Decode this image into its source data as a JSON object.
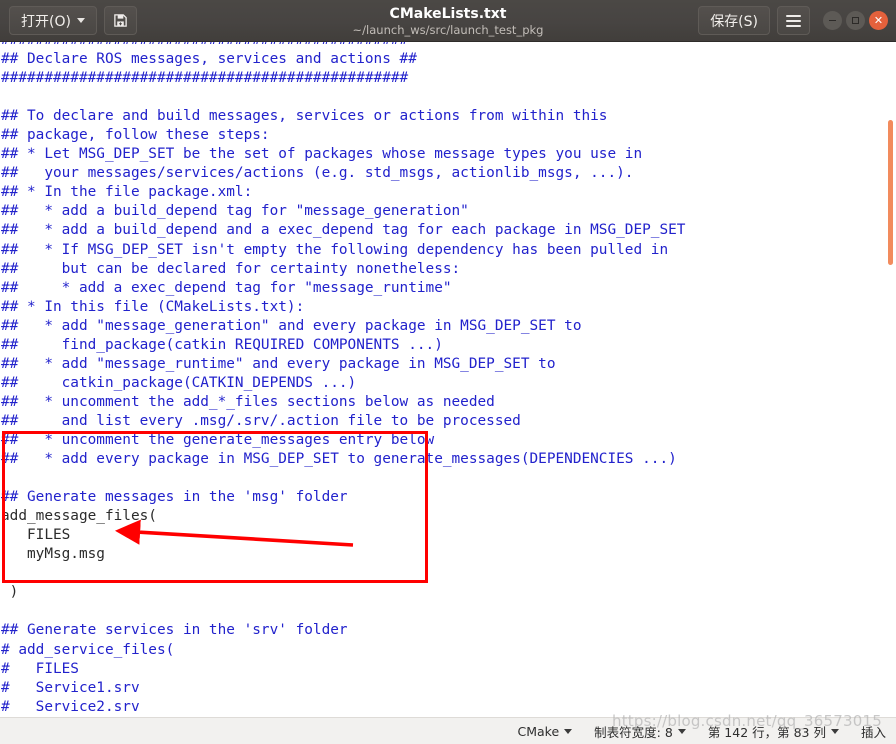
{
  "titlebar": {
    "open_label": "打开(O)",
    "saveas_icon": "save-as-icon",
    "title": "CMakeLists.txt",
    "subtitle": "~/launch_ws/src/launch_test_pkg",
    "save_label": "保存(S)",
    "menu_icon": "hamburger-menu-icon",
    "minimize_icon": "minimize-icon",
    "maximize_icon": "maximize-icon",
    "close_icon": "close-icon"
  },
  "editor": {
    "lines": [
      {
        "text": "###############################################",
        "style": "comment"
      },
      {
        "text": "## Declare ROS messages, services and actions ##",
        "style": "comment"
      },
      {
        "text": "###############################################",
        "style": "comment"
      },
      {
        "text": "",
        "style": "comment"
      },
      {
        "text": "## To declare and build messages, services or actions from within this",
        "style": "comment"
      },
      {
        "text": "## package, follow these steps:",
        "style": "comment"
      },
      {
        "text": "## * Let MSG_DEP_SET be the set of packages whose message types you use in",
        "style": "comment"
      },
      {
        "text": "##   your messages/services/actions (e.g. std_msgs, actionlib_msgs, ...).",
        "style": "comment"
      },
      {
        "text": "## * In the file package.xml:",
        "style": "comment"
      },
      {
        "text": "##   * add a build_depend tag for \"message_generation\"",
        "style": "comment"
      },
      {
        "text": "##   * add a build_depend and a exec_depend tag for each package in MSG_DEP_SET",
        "style": "comment"
      },
      {
        "text": "##   * If MSG_DEP_SET isn't empty the following dependency has been pulled in",
        "style": "comment"
      },
      {
        "text": "##     but can be declared for certainty nonetheless:",
        "style": "comment"
      },
      {
        "text": "##     * add a exec_depend tag for \"message_runtime\"",
        "style": "comment"
      },
      {
        "text": "## * In this file (CMakeLists.txt):",
        "style": "comment"
      },
      {
        "text": "##   * add \"message_generation\" and every package in MSG_DEP_SET to",
        "style": "comment"
      },
      {
        "text": "##     find_package(catkin REQUIRED COMPONENTS ...)",
        "style": "comment"
      },
      {
        "text": "##   * add \"message_runtime\" and every package in MSG_DEP_SET to",
        "style": "comment"
      },
      {
        "text": "##     catkin_package(CATKIN_DEPENDS ...)",
        "style": "comment"
      },
      {
        "text": "##   * uncomment the add_*_files sections below as needed",
        "style": "comment"
      },
      {
        "text": "##     and list every .msg/.srv/.action file to be processed",
        "style": "comment"
      },
      {
        "text": "##   * uncomment the generate_messages entry below",
        "style": "comment"
      },
      {
        "text": "##   * add every package in MSG_DEP_SET to generate_messages(DEPENDENCIES ...)",
        "style": "comment"
      },
      {
        "text": "",
        "style": "comment"
      },
      {
        "text": "## Generate messages in the 'msg' folder",
        "style": "comment"
      },
      {
        "text": "add_message_files(",
        "style": "plain"
      },
      {
        "text": "   FILES",
        "style": "plain"
      },
      {
        "text": "   myMsg.msg",
        "style": "plain"
      },
      {
        "text": "",
        "style": "plain"
      },
      {
        "text": " )",
        "style": "plain"
      },
      {
        "text": "",
        "style": "plain"
      },
      {
        "text": "## Generate services in the 'srv' folder",
        "style": "comment"
      },
      {
        "text": "# add_service_files(",
        "style": "comment"
      },
      {
        "text": "#   FILES",
        "style": "comment"
      },
      {
        "text": "#   Service1.srv",
        "style": "comment"
      },
      {
        "text": "#   Service2.srv",
        "style": "comment"
      },
      {
        "text": "# )",
        "style": "comment"
      }
    ],
    "comment_color": "#2222cc",
    "plain_color": "#2b2b2b",
    "scrollbar_color": "#f28b5d"
  },
  "annotations": {
    "box_color": "#ff0000",
    "arrow_color": "#ff0000",
    "arrow_target": "myMsg.msg"
  },
  "statusbar": {
    "language": "CMake",
    "tab_width": "制表符宽度: 8",
    "position": "第 142 行，第 83 列",
    "insert_mode": "插入"
  },
  "watermark": {
    "text": "https://blog.csdn.net/qq_36573015"
  }
}
